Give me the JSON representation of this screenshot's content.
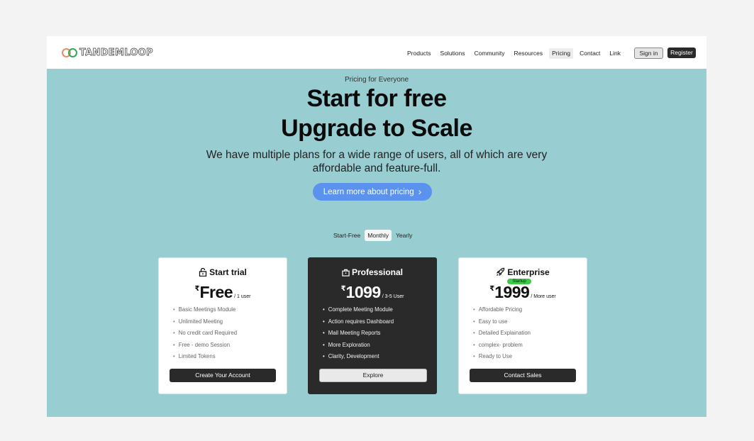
{
  "brand": {
    "name": "TANDEMLOOP"
  },
  "nav": {
    "links": [
      "Products",
      "Solutions",
      "Community",
      "Resources",
      "Pricing",
      "Contact",
      "Link"
    ],
    "active": "Pricing",
    "sign_in": "Sign in",
    "register": "Register"
  },
  "hero": {
    "eyebrow": "Pricing for Everyone",
    "headline_line1": "Start for free",
    "headline_line2": "Upgrade to Scale",
    "subtext": "We have multiple plans for a wide range of users, all of which are very affordable and feature-full.",
    "cta": "Learn more about pricing"
  },
  "billing_toggle": {
    "options": [
      "Start-Free",
      "Monthly",
      "Yearly"
    ],
    "selected": "Monthly"
  },
  "plans": [
    {
      "name": "Start trial",
      "icon": "unlock-icon",
      "currency": "₹",
      "price": "Free",
      "per": "/ 1 user",
      "features": [
        "Basic Meetings Module",
        "Unlimited Meeting",
        "No credit card Required",
        "Free - demo Session",
        "Limited Tokens"
      ],
      "button": "Create Your Account"
    },
    {
      "name": "Professional",
      "icon": "briefcase-icon",
      "currency": "₹",
      "price": "1099",
      "per": "/ 3-5 User",
      "features": [
        "Complete Meeting Module",
        "Action requires Dashboard",
        "Mail Meeting Reports",
        "More Exploration",
        "Clarity, Development"
      ],
      "button": "Explore"
    },
    {
      "name": "Enterprise",
      "icon": "rocket-icon",
      "badge": "Startup",
      "currency": "₹",
      "price": "1999",
      "per": "/ More user",
      "features": [
        "Affordable Pricing",
        "Easy to use",
        "Detailed Explaination",
        "complex- problem",
        "Ready to Use"
      ],
      "button": "Contact Sales"
    }
  ],
  "colors": {
    "hero_bg": "#98cdd2",
    "cta": "#5b92ee",
    "dark": "#2a2a2a",
    "badge": "#3ec94a"
  }
}
